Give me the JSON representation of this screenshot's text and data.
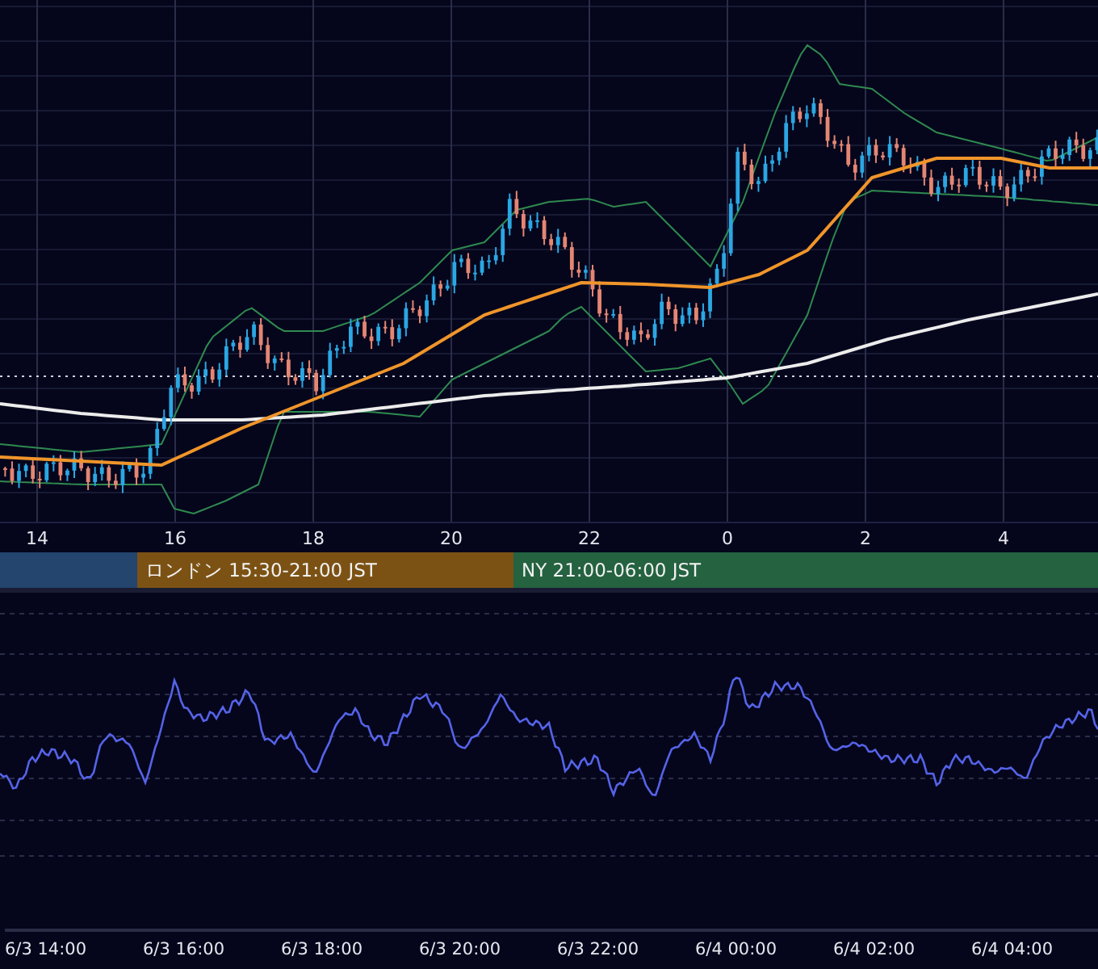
{
  "main_chart": {
    "time_ticks": [
      "14",
      "16",
      "18",
      "20",
      "22",
      "0",
      "2",
      "4"
    ]
  },
  "sessions": [
    {
      "color": "#23456e"
    },
    {
      "label": "ロンドン 15:30-21:00 JST",
      "color": "#7c5214"
    },
    {
      "label": "NY 21:00-06:00 JST",
      "color": "#246240"
    }
  ],
  "oscillator": {
    "time_ticks": [
      "6/3 14:00",
      "6/3 16:00",
      "6/3 18:00",
      "6/3 20:00",
      "6/3 22:00",
      "6/4 00:00",
      "6/4 02:00",
      "6/4 04:00"
    ]
  }
}
